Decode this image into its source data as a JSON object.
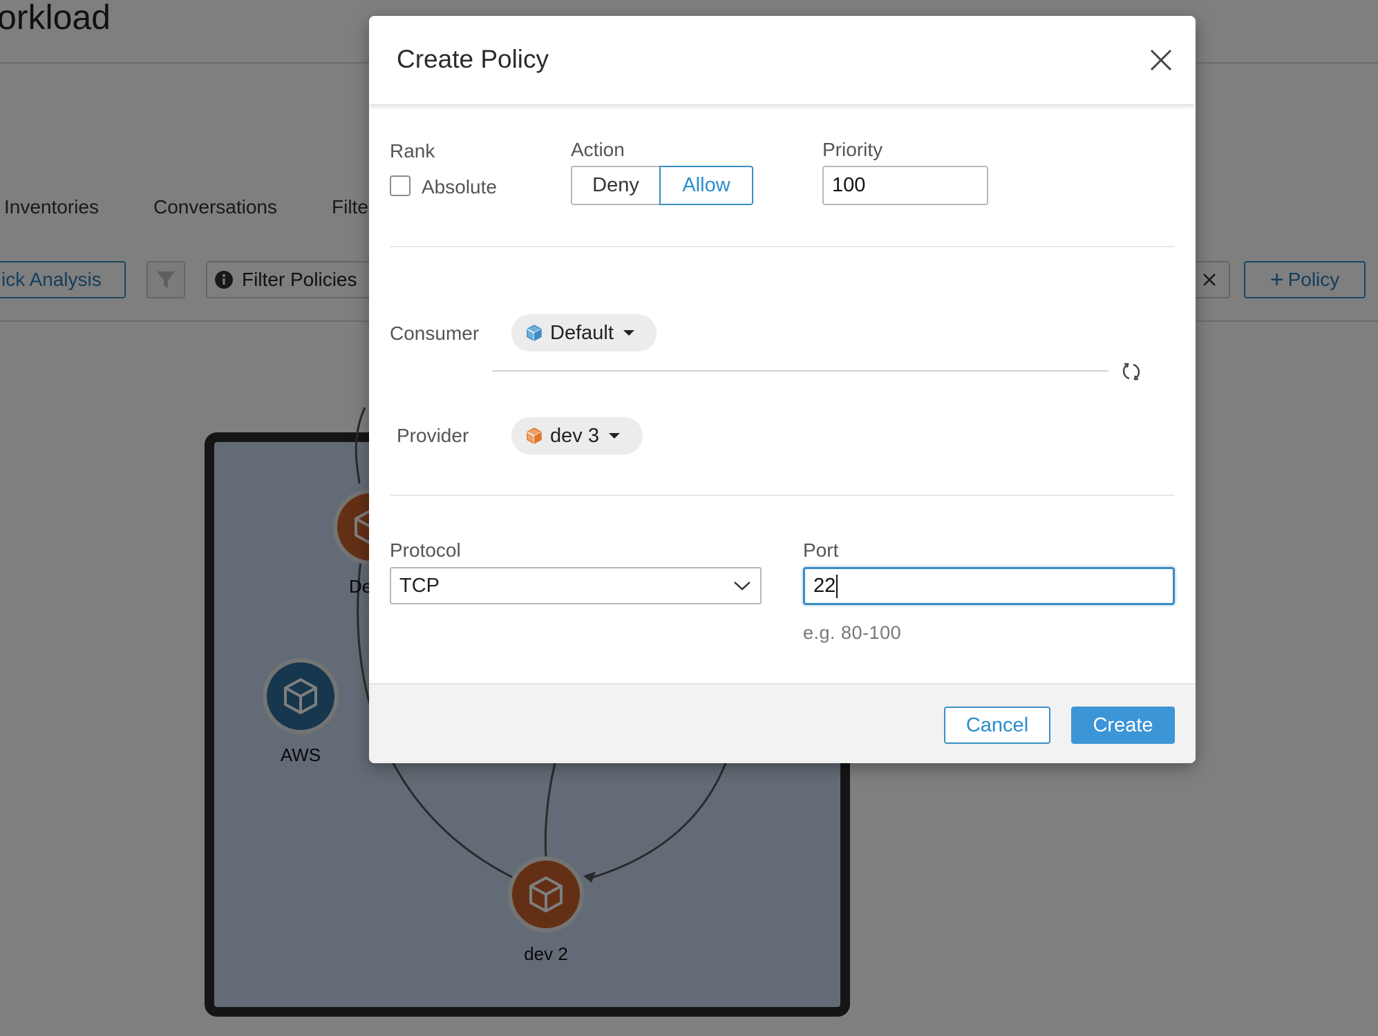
{
  "background": {
    "page_title": "orkload",
    "tabs": [
      "Inventories",
      "Conversations",
      "Filte"
    ],
    "quick_analysis_label": "ick Analysis",
    "filter_policies_label": "Filter Policies",
    "add_policy_label": "Policy",
    "graph": {
      "nodes": [
        {
          "label": "AWS",
          "color": "#2e6e9e"
        },
        {
          "label": "dev 2",
          "color": "#c9602a"
        },
        {
          "label": "De",
          "color": "#c9602a"
        }
      ]
    }
  },
  "modal": {
    "title": "Create Policy",
    "rank": {
      "label": "Rank",
      "checkbox_label": "Absolute",
      "checked": false
    },
    "action": {
      "label": "Action",
      "options": [
        "Deny",
        "Allow"
      ],
      "selected": "Allow"
    },
    "priority": {
      "label": "Priority",
      "value": "100"
    },
    "consumer": {
      "label": "Consumer",
      "value": "Default",
      "icon": "cube-icon",
      "icon_color": "#3b8cc4"
    },
    "provider": {
      "label": "Provider",
      "value": "dev 3",
      "icon": "cube-icon",
      "icon_color": "#e0762c"
    },
    "protocol": {
      "label": "Protocol",
      "value": "TCP"
    },
    "port": {
      "label": "Port",
      "value": "22",
      "hint": "e.g. 80-100"
    },
    "buttons": {
      "cancel": "Cancel",
      "create": "Create"
    }
  },
  "colors": {
    "accent": "#3b8cc4",
    "primary_button": "#3c95d6",
    "overlay": "rgba(0,0,0,0.5)"
  }
}
